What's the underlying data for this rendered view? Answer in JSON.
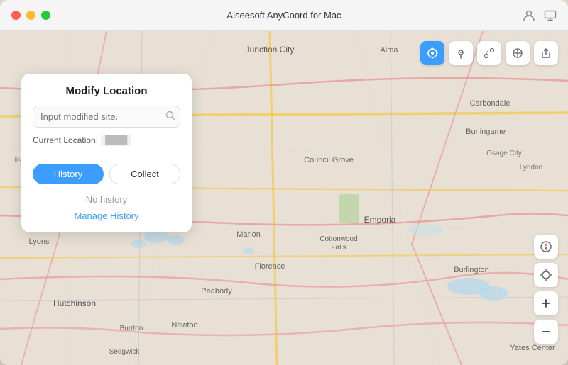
{
  "window": {
    "title": "Aiseesoft AnyCoord for Mac"
  },
  "titlebar": {
    "title": "Aiseesoft AnyCoord for Mac",
    "right_icons": [
      "person-icon",
      "display-icon"
    ]
  },
  "map_toolbar": {
    "buttons": [
      {
        "id": "location-btn",
        "icon": "📍",
        "active": true
      },
      {
        "id": "pin-btn",
        "icon": "📌",
        "active": false
      },
      {
        "id": "route-btn",
        "icon": "⬡",
        "active": false
      },
      {
        "id": "multi-route-btn",
        "icon": "⊕",
        "active": false
      },
      {
        "id": "export-btn",
        "icon": "→",
        "active": false
      }
    ]
  },
  "right_controls": {
    "buttons": [
      {
        "id": "compass-btn",
        "icon": "◎"
      },
      {
        "id": "crosshair-btn",
        "icon": "⊕"
      },
      {
        "id": "zoom-in-btn",
        "icon": "+"
      },
      {
        "id": "zoom-out-btn",
        "icon": "−"
      }
    ]
  },
  "modify_panel": {
    "title": "Modify Location",
    "search_placeholder": "Input modified site.",
    "current_location_label": "Current Location:",
    "current_location_value": "░░░░░",
    "tabs": [
      {
        "id": "history",
        "label": "History",
        "active": true
      },
      {
        "id": "collect",
        "label": "Collect",
        "active": false
      }
    ],
    "no_history_text": "No history",
    "manage_history_link": "Manage History"
  }
}
